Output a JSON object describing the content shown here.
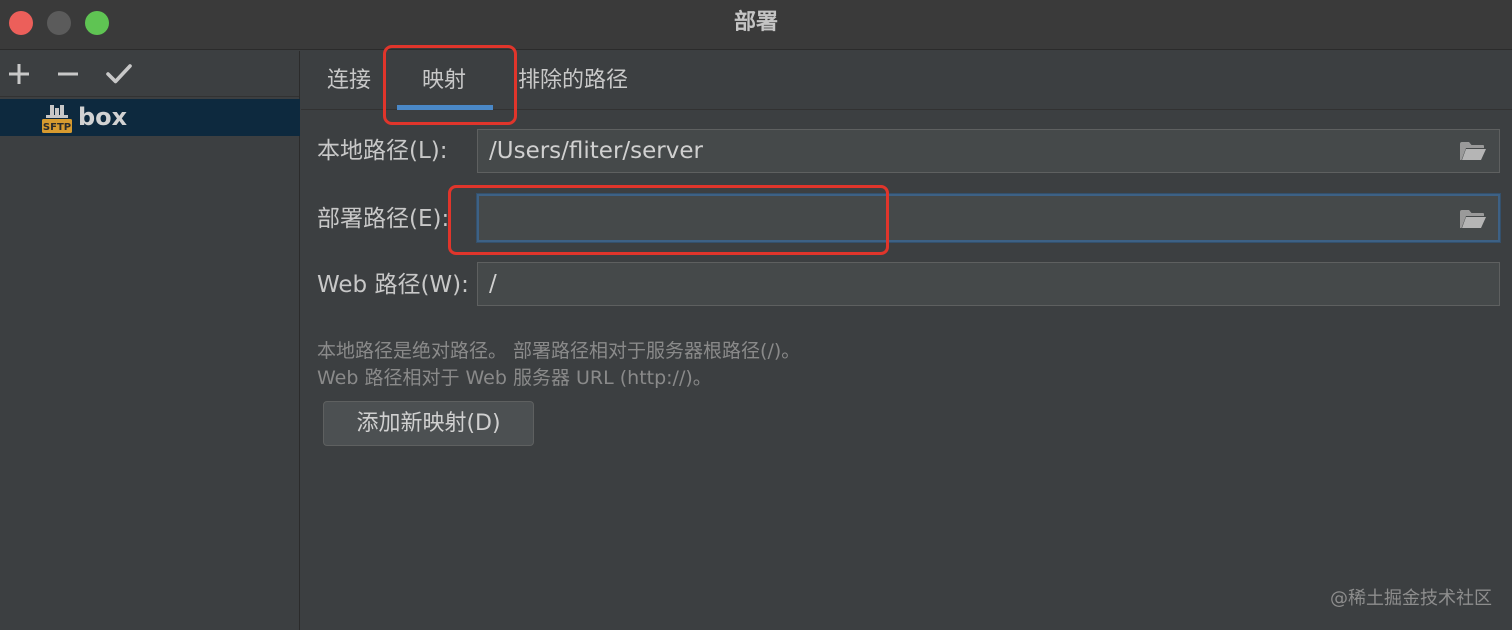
{
  "window": {
    "title": "部署"
  },
  "sidebar": {
    "toolbar": {
      "add": "+",
      "remove": "−",
      "apply": "✓"
    },
    "items": [
      {
        "label": "box",
        "icon": "sftp-icon",
        "icon_text": "SFTP",
        "selected": true
      }
    ]
  },
  "tabs": [
    {
      "label": "连接",
      "active": false
    },
    {
      "label": "映射",
      "active": true
    },
    {
      "label": "排除的路径",
      "active": false
    }
  ],
  "fields": {
    "local": {
      "label": "本地路径(L):",
      "value": "/Users/fliter/server"
    },
    "deploy": {
      "label": "部署路径(E):",
      "value": ""
    },
    "web": {
      "label": "Web 路径(W):",
      "value": "/"
    }
  },
  "hints": [
    "本地路径是绝对路径。 部署路径相对于服务器根路径(/)。",
    "Web 路径相对于 Web 服务器 URL (http://)。"
  ],
  "add_mapping_button": "添加新映射(D)",
  "watermark": "@稀土掘金技术社区",
  "colors": {
    "background": "#3c3f41",
    "selection": "#0d293e",
    "accent": "#4a88c7",
    "highlight": "#e0352b"
  }
}
